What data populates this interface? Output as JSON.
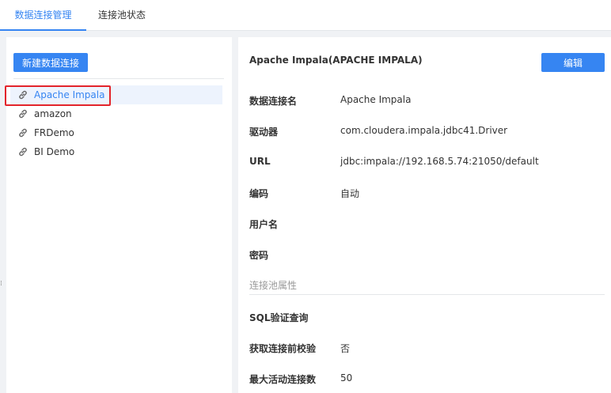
{
  "tabs": [
    {
      "label": "数据连接管理",
      "active": true
    },
    {
      "label": "连接池状态",
      "active": false
    }
  ],
  "left": {
    "new_button": "新建数据连接",
    "connections": [
      {
        "label": "Apache Impala",
        "icon": "link-icon",
        "selected": true
      },
      {
        "label": "amazon",
        "icon": "link-icon",
        "selected": false
      },
      {
        "label": "FRDemo",
        "icon": "link-icon",
        "selected": false
      },
      {
        "label": "BI Demo",
        "icon": "link-icon",
        "selected": false
      }
    ]
  },
  "detail": {
    "title": "Apache Impala(APACHE IMPALA)",
    "edit_button": "编辑",
    "fields": [
      {
        "label": "数据连接名",
        "value": "Apache Impala"
      },
      {
        "label": "驱动器",
        "value": "com.cloudera.impala.jdbc41.Driver"
      },
      {
        "label": "URL",
        "value": "jdbc:impala://192.168.5.74:21050/default"
      },
      {
        "label": "编码",
        "value": "自动"
      },
      {
        "label": "用户名",
        "value": ""
      },
      {
        "label": "密码",
        "value": ""
      }
    ],
    "pool_section_label": "连接池属性",
    "pool_fields": [
      {
        "label": "SQL验证查询",
        "value": ""
      },
      {
        "label": "获取连接前校验",
        "value": "否"
      },
      {
        "label": "最大活动连接数",
        "value": "50"
      }
    ]
  },
  "colors": {
    "accent": "#3685f2",
    "highlight": "#e3242b",
    "selected_bg": "#edf3fd"
  }
}
